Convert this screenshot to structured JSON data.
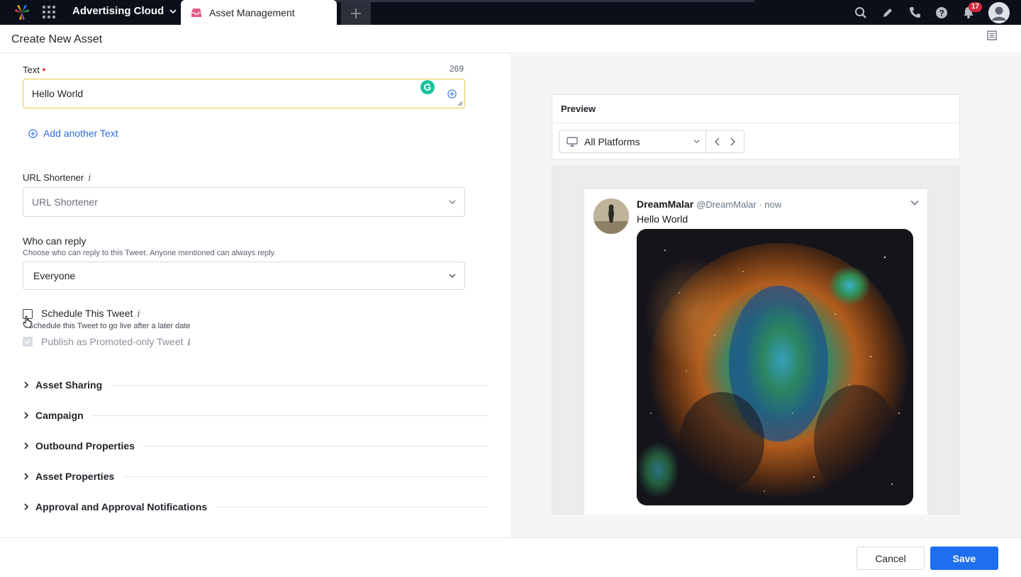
{
  "topbar": {
    "app_name": "Advertising Cloud",
    "active_tab": "Asset Management",
    "notification_count": "17"
  },
  "header": {
    "title": "Create New Asset"
  },
  "form": {
    "text_label": "Text",
    "text_counter": "269",
    "text_value": "Hello World",
    "add_another_label": "Add another Text",
    "url_shortener_label": "URL Shortener",
    "url_shortener_placeholder": "URL Shortener",
    "who_can_reply_label": "Who can reply",
    "who_can_reply_help": "Choose who can reply to this Tweet. Anyone mentioned can always reply.",
    "who_can_reply_value": "Everyone",
    "schedule_label": "Schedule This Tweet",
    "schedule_help": "Schedule this Tweet to go live after a later date",
    "promoted_label": "Publish as Promoted-only Tweet",
    "info_glyph": "i"
  },
  "sections": [
    {
      "title": "Asset Sharing"
    },
    {
      "title": "Campaign"
    },
    {
      "title": "Outbound Properties"
    },
    {
      "title": "Asset Properties"
    },
    {
      "title": "Approval and Approval Notifications"
    }
  ],
  "preview": {
    "title": "Preview",
    "platform": "All Platforms",
    "tweet": {
      "name": "DreamMalar",
      "handle": "@DreamMalar · now",
      "text": "Hello World"
    }
  },
  "footer": {
    "cancel_label": "Cancel",
    "save_label": "Save"
  },
  "colors": {
    "topbar": "#0b0f19",
    "primary": "#1e6ef0",
    "link": "#2d6cdf",
    "focus_border": "#e9c84a",
    "badge": "#d7263d"
  }
}
